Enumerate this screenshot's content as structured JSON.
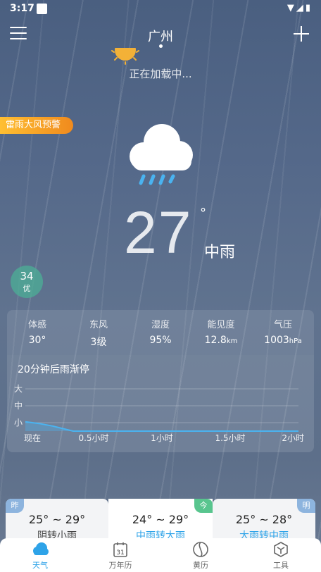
{
  "status_bar": {
    "time": "3:17",
    "right_icons": "▼◢▮"
  },
  "header": {
    "city": "广州"
  },
  "loading_text": "正在加载中...",
  "warning_label": "雷雨大风预警",
  "current": {
    "temperature": "27",
    "degree_symbol": "°",
    "condition": "中雨",
    "aqi_value": "34",
    "aqi_level": "优"
  },
  "details": [
    {
      "label": "体感",
      "value": "30°",
      "unit": ""
    },
    {
      "label": "东风",
      "value": "3级",
      "unit": ""
    },
    {
      "label": "湿度",
      "value": "95%",
      "unit": ""
    },
    {
      "label": "能见度",
      "value": "12.8",
      "unit": "km"
    },
    {
      "label": "气压",
      "value": "1003",
      "unit": "hPa"
    }
  ],
  "precip": {
    "title": "20分钟后雨渐停",
    "y_labels": [
      "大",
      "中",
      "小"
    ],
    "x_labels": [
      "现在",
      "0.5小时",
      "1小时",
      "1.5小时",
      "2小时"
    ]
  },
  "chart_data": {
    "type": "area",
    "title": "20分钟后雨渐停",
    "x": [
      0,
      0.1,
      0.2,
      0.3,
      0.35,
      0.4,
      2.0
    ],
    "x_tick_labels": [
      "现在",
      "0.5小时",
      "1小时",
      "1.5小时",
      "2小时"
    ],
    "y_categories": [
      "小",
      "中",
      "大"
    ],
    "values": [
      0.55,
      0.45,
      0.3,
      0.1,
      0.0,
      0.0,
      0.0
    ],
    "ylim": [
      0,
      2
    ],
    "color": "#4ab3f0"
  },
  "forecast": {
    "yesterday": {
      "badge": "昨",
      "range": "25° ~ 29°",
      "condition": "阴转小雨"
    },
    "today": {
      "badge": "今",
      "range": "24° ~ 29°",
      "condition": "中雨转大雨"
    },
    "tomorrow": {
      "badge": "明",
      "range": "25° ~ 28°",
      "condition": "大雨转中雨"
    }
  },
  "nav": {
    "weather": "天气",
    "calendar": "万年历",
    "calendar_day": "31",
    "almanac": "黄历",
    "tools": "工具"
  },
  "colors": {
    "accent": "#2ea3e8",
    "warning": "#f5a623",
    "aqi": "#4caf96",
    "sun": "#f3b137"
  }
}
